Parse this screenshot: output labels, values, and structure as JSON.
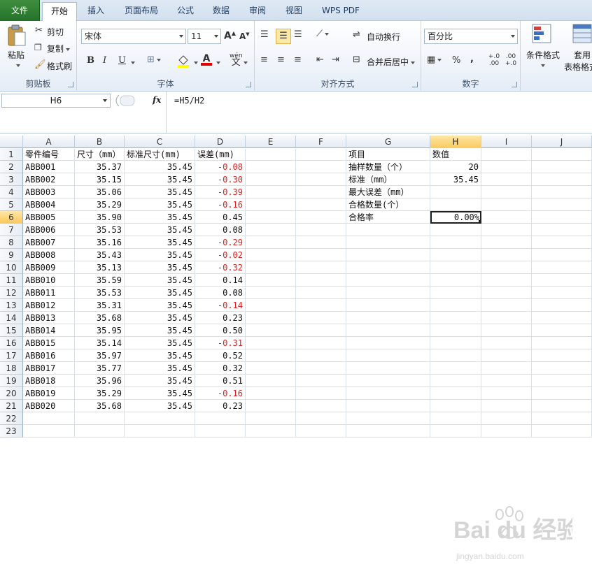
{
  "tabs": [
    "文件",
    "开始",
    "插入",
    "页面布局",
    "公式",
    "数据",
    "审阅",
    "视图",
    "WPS PDF"
  ],
  "ribbon": {
    "clipboard": {
      "label": "剪贴板",
      "paste": "粘贴",
      "cut": "剪切",
      "copy": "复制",
      "format_painter": "格式刷"
    },
    "font": {
      "label": "字体",
      "name": "宋体",
      "size": "11",
      "bold": "B",
      "italic": "I",
      "underline": "U",
      "wen": "wén",
      "wen2": "文",
      "grow": "A",
      "shrink": "A",
      "fontcolor": "A"
    },
    "align": {
      "label": "对齐方式",
      "wrap": "自动换行",
      "merge": "合并后居中"
    },
    "number": {
      "label": "数字",
      "format": "百分比",
      "percent": "%",
      "comma": ",",
      "inc": "+.0 .00",
      "dec": ".00 +.0"
    },
    "styles": {
      "cond": "条件格式",
      "table": "套用",
      "table2": "表格格式"
    }
  },
  "namebox": "H6",
  "fx": "fx",
  "formula": "=H5/H2",
  "columns": [
    "A",
    "B",
    "C",
    "D",
    "E",
    "F",
    "G",
    "H",
    "I",
    "J"
  ],
  "header_row": [
    "零件编号",
    "尺寸（mm）",
    "标准尺寸(mm)",
    "误差(mm)"
  ],
  "rows": [
    [
      "ABB001",
      "35.37",
      "35.45",
      "-0.08"
    ],
    [
      "ABB002",
      "35.15",
      "35.45",
      "-0.30"
    ],
    [
      "ABB003",
      "35.06",
      "35.45",
      "-0.39"
    ],
    [
      "ABB004",
      "35.29",
      "35.45",
      "-0.16"
    ],
    [
      "ABB005",
      "35.90",
      "35.45",
      "0.45"
    ],
    [
      "ABB006",
      "35.53",
      "35.45",
      "0.08"
    ],
    [
      "ABB007",
      "35.16",
      "35.45",
      "-0.29"
    ],
    [
      "ABB008",
      "35.43",
      "35.45",
      "-0.02"
    ],
    [
      "ABB009",
      "35.13",
      "35.45",
      "-0.32"
    ],
    [
      "ABB010",
      "35.59",
      "35.45",
      "0.14"
    ],
    [
      "ABB011",
      "35.53",
      "35.45",
      "0.08"
    ],
    [
      "ABB012",
      "35.31",
      "35.45",
      "-0.14"
    ],
    [
      "ABB013",
      "35.68",
      "35.45",
      "0.23"
    ],
    [
      "ABB014",
      "35.95",
      "35.45",
      "0.50"
    ],
    [
      "ABB015",
      "35.14",
      "35.45",
      "-0.31"
    ],
    [
      "ABB016",
      "35.97",
      "35.45",
      "0.52"
    ],
    [
      "ABB017",
      "35.77",
      "35.45",
      "0.32"
    ],
    [
      "ABB018",
      "35.96",
      "35.45",
      "0.51"
    ],
    [
      "ABB019",
      "35.29",
      "35.45",
      "-0.16"
    ],
    [
      "ABB020",
      "35.68",
      "35.45",
      "0.23"
    ]
  ],
  "summary": [
    [
      "项目",
      "数值"
    ],
    [
      "抽样数量（个）",
      "20"
    ],
    [
      "标准（mm）",
      "35.45"
    ],
    [
      "最大误差（mm）",
      ""
    ],
    [
      "合格数量(个）",
      ""
    ],
    [
      "合格率",
      "0.00%"
    ]
  ],
  "watermark": {
    "brand": "Bai du 经验",
    "url": "jingyan.baidu.com"
  }
}
